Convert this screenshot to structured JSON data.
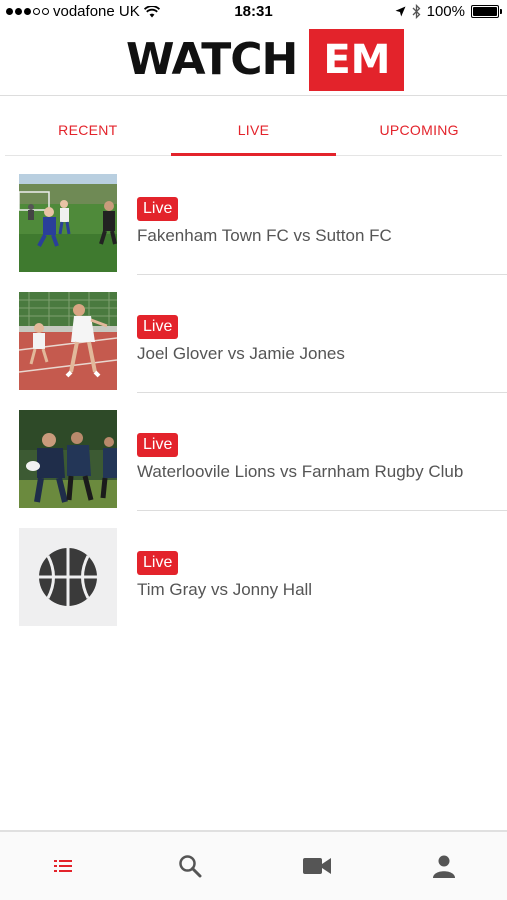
{
  "status_bar": {
    "carrier": "vodafone UK",
    "time": "18:31",
    "battery": "100%",
    "battery_level": 1.0,
    "signal_bars_filled": 3,
    "signal_bars_total": 5,
    "icons": [
      "wifi-icon",
      "location-arrow-icon",
      "bluetooth-icon",
      "battery-icon"
    ]
  },
  "header": {
    "logo_word": "WATCH",
    "logo_badge": "EM"
  },
  "tabs": [
    {
      "label": "RECENT",
      "active": false
    },
    {
      "label": "LIVE",
      "active": true
    },
    {
      "label": "UPCOMING",
      "active": false
    }
  ],
  "events": [
    {
      "badge": "Live",
      "title": "Fakenham Town FC vs Sutton FC",
      "thumbnail": "football-photo"
    },
    {
      "badge": "Live",
      "title": "Joel Glover vs Jamie Jones",
      "thumbnail": "tennis-photo"
    },
    {
      "badge": "Live",
      "title": "Waterloovile Lions vs Farnham Rugby Club",
      "thumbnail": "rugby-photo"
    },
    {
      "badge": "Live",
      "title": "Tim Gray vs Jonny Hall",
      "thumbnail": "basketball-icon"
    }
  ],
  "bottom_nav": [
    {
      "icon": "list-icon",
      "active": true
    },
    {
      "icon": "search-icon",
      "active": false
    },
    {
      "icon": "video-camera-icon",
      "active": false
    },
    {
      "icon": "profile-icon",
      "active": false
    }
  ],
  "colors": {
    "accent": "#e3232b",
    "text_secondary": "#555555",
    "icon_inactive": "#555555",
    "divider": "#dddddd"
  }
}
